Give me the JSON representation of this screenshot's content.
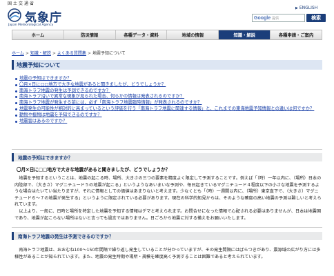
{
  "header": {
    "ministry": "国土交通省",
    "logo_text": "気象庁",
    "logo_en": "Japan Meteorological Agency",
    "english_link": "ENGLISH",
    "search_logo": "Google",
    "search_hint": "提供",
    "search_button": "検索"
  },
  "nav": [
    {
      "label": "ホーム",
      "active": false
    },
    {
      "label": "防災情報",
      "active": false
    },
    {
      "label": "各種データ・資料",
      "active": false
    },
    {
      "label": "地域の情報",
      "active": false
    },
    {
      "label": "知識・解説",
      "active": true
    },
    {
      "label": "各種申請・ご案内",
      "active": false
    }
  ],
  "breadcrumb": [
    "ホーム",
    "知識・解説",
    "よくある質問集",
    "地震予知について"
  ],
  "page_title": "地震予知について",
  "faq": [
    "地震の予知はできますか？",
    "〇月×日に□□地方で大きな地震があると聞きましたが、どうでしょうか？",
    "南海トラフ地震の発生は予測できるのですか？",
    "南海トラフ沿いで異常な現象が見られた場合、何らかの情報は発表されるのですか？",
    "南海トラフ地震が発生する前には、必ず「南海トラフ地震臨時情報」が発表されるのですか？",
    "地震発生の可能性が相対的に高まっているという評価を行う「南海トラフ地震に関連する情報」と、これまでの東海地震予知情報との違いは何ですか？",
    "動物や植物は地震を予知できるのですか？",
    "地震雲はあるのですか？"
  ],
  "section1": {
    "heading": "地震の予知はできますか？",
    "question": "〇月×日に□□地方で大きな地震があると聞きましたが、どうでしょうか？",
    "para1": "地震を予知するということは、地震の起こる時、場所、大きさの三つの要素を精度よく限定して予測することです。例えば「（時）一年以内に、（場所）日本の内陸部で、（大きさ）マグニチュード５の地震が起こる」というようなあいまいな予測や、毎日起きているマグニチュード４程度以下の小さな地震を予測するような場合はたいてい当たりますが、それに情報としての価値はあまりないと考えます。少なくとも「（時）一週間以内に、（場所）東京直下で、（大きさ）マグニチュード６～７の地震が発生する」というように限定されている必要があります。現在の科学的知見からは、そのような確度の高い地震の予測は難しいと考えられています。",
    "para2": "以上より、一般に、日時と場所を特定した地震を予知する情報はデマと考えられます。お問合せになった情報で心配される必要はありませんが、日本は地震国であり、地震が起こらない場所はないと言っても過言ではありません。日ごろから地震に対する備えをお願いいたします。"
  },
  "section2": {
    "heading": "南海トラフ地震の発生は予測できるのですか？",
    "para1": "南海トラフ地震は、おおむね100～150年間隔で繰り返し発生していることが分かっていますが、その発生間隔にはばらつきがあり、震源域の広がり方には多様性があることが知られています。また、地震の発生時期や場所・規模を確度高く予測することは困難であると考えられています。"
  }
}
